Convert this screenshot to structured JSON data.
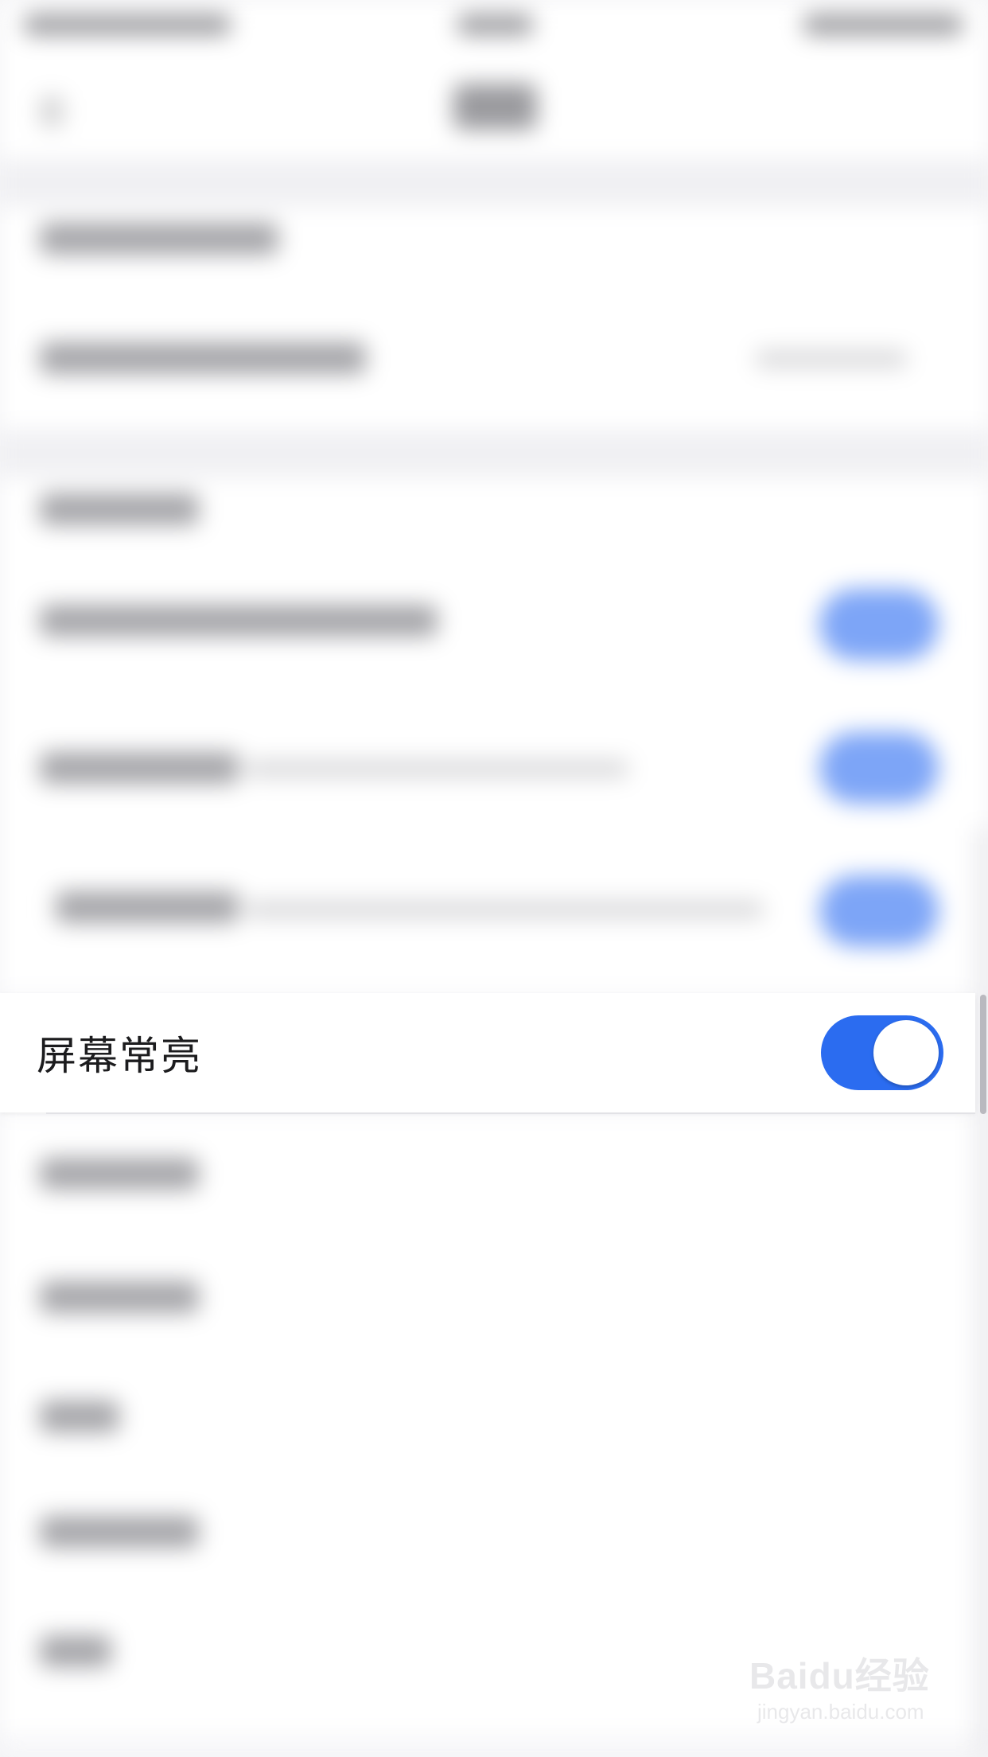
{
  "setting_row": {
    "label": "屏幕常亮",
    "toggle_state": "on"
  },
  "colors": {
    "toggle_on": "#2b6cf0",
    "background": "#f4f4f6"
  },
  "watermark": {
    "logo": "Baidu经验",
    "url": "jingyan.baidu.com"
  }
}
